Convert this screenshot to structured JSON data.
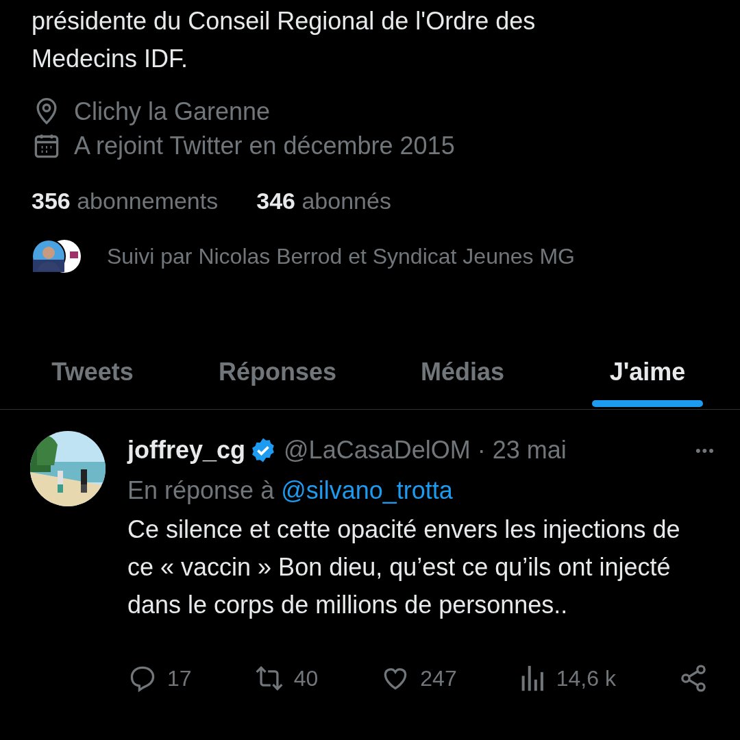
{
  "profile": {
    "bio_lines": [
      "présidente du Conseil Regional de l'Ordre des",
      "Medecins IDF."
    ],
    "location": "Clichy la Garenne",
    "joined": "A rejoint Twitter en décembre 2015",
    "following": {
      "count": "356",
      "label": "abonnements"
    },
    "followers": {
      "count": "346",
      "label": "abonnés"
    },
    "followed_by": "Suivi par Nicolas Berrod et Syndicat Jeunes MG"
  },
  "tabs": [
    {
      "label": "Tweets",
      "selected": false
    },
    {
      "label": "Réponses",
      "selected": false
    },
    {
      "label": "Médias",
      "selected": false
    },
    {
      "label": "J'aime",
      "selected": true
    }
  ],
  "tweet": {
    "name": "joffrey_cg",
    "verified": true,
    "handle": "@LaCasaDelOM",
    "separator": "·",
    "date": "23 mai",
    "menu": "•••",
    "reply_prefix": "En réponse à",
    "reply_to": "@silvano_trotta",
    "text": "Ce silence et cette opacité envers les injections de ce « vaccin » Bon dieu, qu’est ce qu’ils ont injecté dans le corps de millions de personnes..",
    "actions": [
      {
        "kind": "reply",
        "count": "17"
      },
      {
        "kind": "retweet",
        "count": "40"
      },
      {
        "kind": "like",
        "count": "247"
      },
      {
        "kind": "views",
        "count": "14,6 k"
      },
      {
        "kind": "share"
      }
    ]
  }
}
